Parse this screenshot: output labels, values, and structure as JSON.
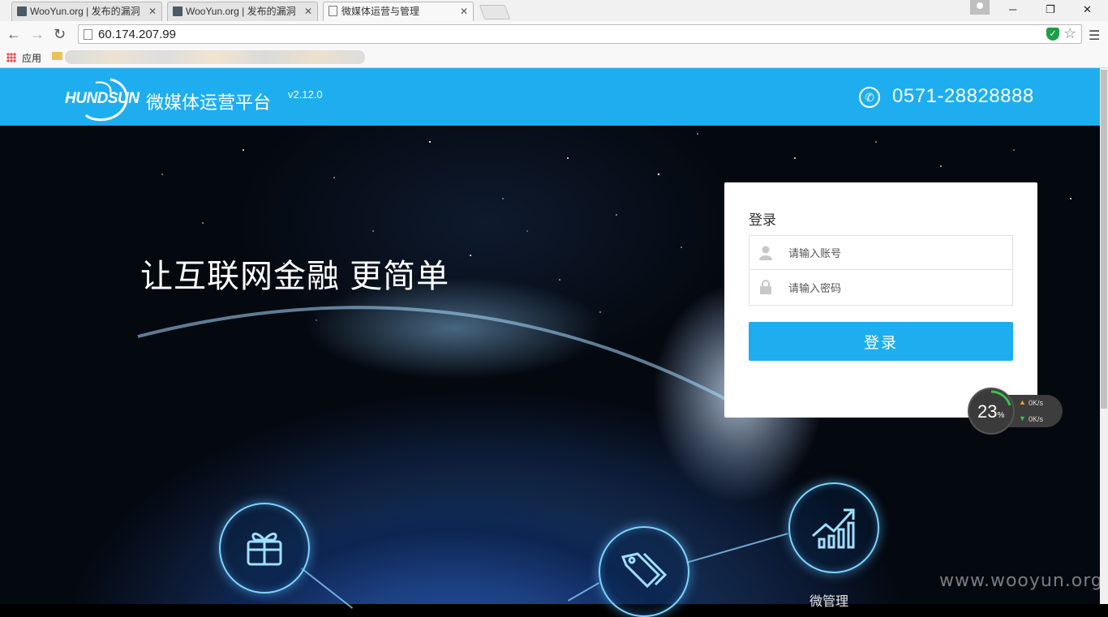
{
  "browser": {
    "tabs": [
      {
        "title": "WooYun.org | 发布的漏洞",
        "active": false
      },
      {
        "title": "WooYun.org | 发布的漏洞",
        "active": false
      },
      {
        "title": "微媒体运营与管理",
        "active": true
      }
    ],
    "url": "60.174.207.99",
    "bookmarks": {
      "apps_label": "应用"
    },
    "icons": [
      "back-icon",
      "forward-icon",
      "reload-icon",
      "page-icon",
      "shield-icon",
      "star-icon",
      "menu-icon"
    ]
  },
  "header": {
    "logo_text": "HUNDSUN",
    "product_name": "微媒体运营平台",
    "version": "v2.12.0",
    "phone": "0571-28828888",
    "background_color": "#1eaeef"
  },
  "hero": {
    "slogan": "让互联网金融 更简单",
    "features": [
      "gift-icon",
      "tag-icon",
      "growth-chart-icon"
    ],
    "partial_label": "微管理"
  },
  "login": {
    "title": "登录",
    "username_placeholder": "请输入账号",
    "password_placeholder": "请输入密码",
    "submit_label": "登录",
    "accent_color": "#1eaeef"
  },
  "speed_widget": {
    "percent": "23",
    "percent_unit": "%",
    "upload": "0K/s",
    "download": "0K/s"
  },
  "watermark": "www.wooyun.org"
}
